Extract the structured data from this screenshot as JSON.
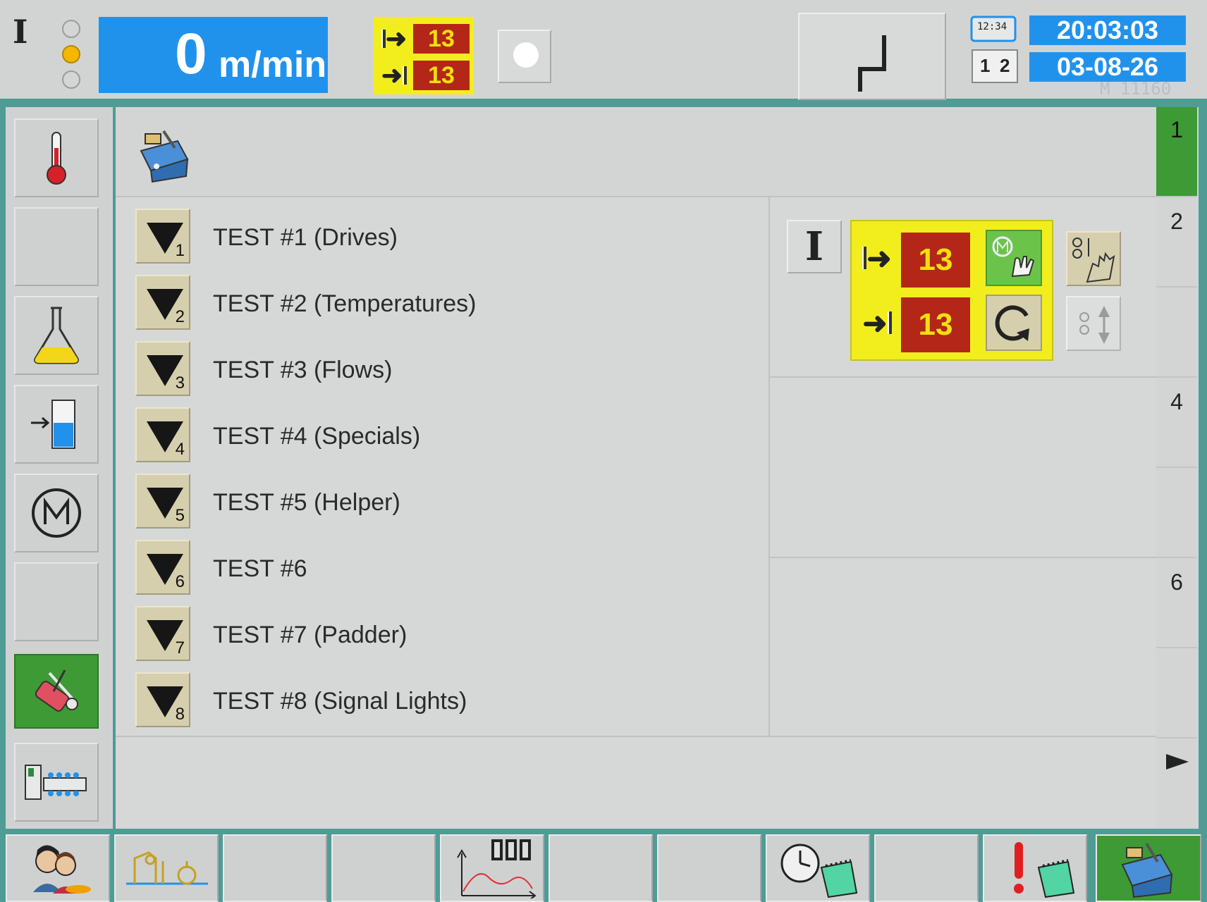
{
  "topbar": {
    "mode_label": "I",
    "speed_value": "0",
    "speed_unit": "m/min",
    "counter_top": "13",
    "counter_bottom": "13",
    "time": "20:03:03",
    "date": "03-08-26",
    "clock_icon_text": "12:34",
    "calendar_icon_text_1": "1",
    "calendar_icon_text_2": "2",
    "machine_id": "M 11160"
  },
  "sidebar": {
    "items": [
      {
        "name": "temperature-icon"
      },
      {
        "name": "empty"
      },
      {
        "name": "flask-icon"
      },
      {
        "name": "tank-level-icon"
      },
      {
        "name": "motor-icon",
        "label": "M"
      },
      {
        "name": "empty"
      },
      {
        "name": "service-tools-icon",
        "active": true
      },
      {
        "name": "machine-layout-icon"
      }
    ]
  },
  "tests": [
    {
      "num": "1",
      "label": "TEST #1 (Drives)"
    },
    {
      "num": "2",
      "label": "TEST #2 (Temperatures)"
    },
    {
      "num": "3",
      "label": "TEST #3 (Flows)"
    },
    {
      "num": "4",
      "label": "TEST #4 (Specials)"
    },
    {
      "num": "5",
      "label": "TEST #5 (Helper)"
    },
    {
      "num": "6",
      "label": "TEST #6"
    },
    {
      "num": "7",
      "label": "TEST #7 (Padder)"
    },
    {
      "num": "8",
      "label": "TEST #8 (Signal Lights)"
    }
  ],
  "control_panel": {
    "mode_label": "I",
    "counter_top": "13",
    "counter_bottom": "13"
  },
  "right_strip": {
    "numbers": [
      "1",
      "2",
      "",
      "4",
      "",
      "6",
      "",
      ""
    ]
  },
  "colors": {
    "accent_blue": "#2192ec",
    "active_green": "#3e9a34",
    "counter_red": "#b42618",
    "counter_yellow": "#f2ee1e",
    "frame_teal": "#4f9c95"
  }
}
